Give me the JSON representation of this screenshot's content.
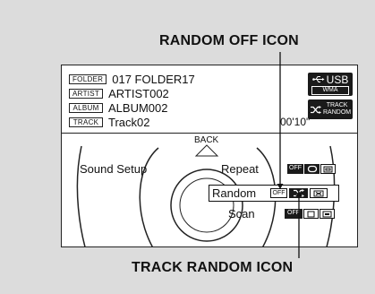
{
  "callouts": {
    "top": "RANDOM OFF ICON",
    "bottom": "TRACK RANDOM ICON"
  },
  "screen": {
    "info_rows": [
      {
        "tag": "FOLDER",
        "value": "017 FOLDER17"
      },
      {
        "tag": "ARTIST",
        "value": "ARTIST002"
      },
      {
        "tag": "ALBUM",
        "value": "ALBUM002"
      },
      {
        "tag": "TRACK",
        "value": "Track02"
      }
    ],
    "elapsed_time": "00'10\"",
    "source": {
      "label": "USB",
      "format": "WMA",
      "icon": "usb-icon"
    },
    "mode_badge": {
      "line1": "TRACK",
      "line2": "RANDOM",
      "icon": "shuffle-icon"
    },
    "back_label": "BACK",
    "menu": {
      "left_item": "Sound Setup",
      "items": [
        {
          "label": "Repeat",
          "options": [
            "OFF",
            "repeat-icon",
            "repeat-folder-icon"
          ]
        },
        {
          "label": "Random",
          "options": [
            "OFF",
            "shuffle-icon",
            "shuffle-folder-icon"
          ],
          "selected_option": "shuffle-icon"
        },
        {
          "label": "Scan",
          "options": [
            "OFF",
            "scan-icon",
            "scan-folder-icon"
          ]
        }
      ]
    }
  },
  "colors": {
    "background": "#dcdcdc",
    "screen": "#ffffff",
    "dark": "#1a1a1a"
  }
}
